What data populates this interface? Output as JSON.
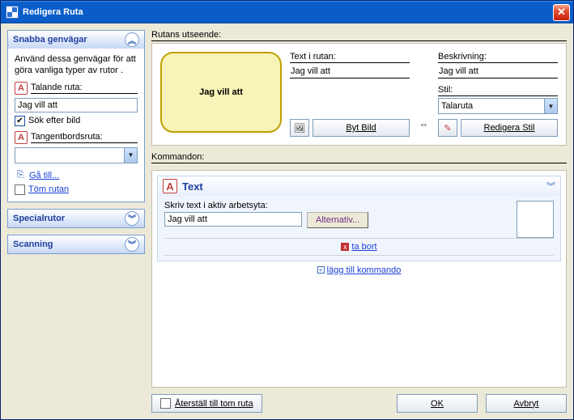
{
  "window": {
    "title": "Redigera Ruta"
  },
  "sidebar": {
    "panel1": {
      "title": "Snabba genvägar",
      "desc": "Använd dessa genvägar för att göra vanliga typer av rutor .",
      "talande_label": "Talande ruta:",
      "talande_value": "Jag vill att ",
      "sok_label": "Sök efter bild",
      "tangent_label": "Tangentbordsruta:",
      "tangent_value": "",
      "goto_label": "Gå till...",
      "tom_label": "Töm rutan"
    },
    "panel2": {
      "title": "Specialrutor"
    },
    "panel3": {
      "title": "Scanning"
    }
  },
  "appearance": {
    "section_label": "Rutans utseende:",
    "preview_text": "Jag vill att",
    "text_label": "Text i rutan:",
    "text_value": "Jag vill att",
    "besk_label": "Beskrivning:",
    "besk_value": "Jag vill att",
    "stil_label": "Stil:",
    "stil_value": "Talaruta",
    "byt_bild": "Byt Bild",
    "redigera_stil": "Redigera Stil"
  },
  "commands": {
    "section_label": "Kommandon:",
    "cmd_title": "Text",
    "skriv_label": "Skriv text i aktiv arbetsyta:",
    "skriv_value": "Jag vill att",
    "alternativ": "Alternativ...",
    "ta_bort": "ta bort",
    "lagg_till": "lägg till kommando"
  },
  "footer": {
    "reset": "Återställ till tom ruta",
    "ok": "OK",
    "cancel": "Avbryt"
  }
}
